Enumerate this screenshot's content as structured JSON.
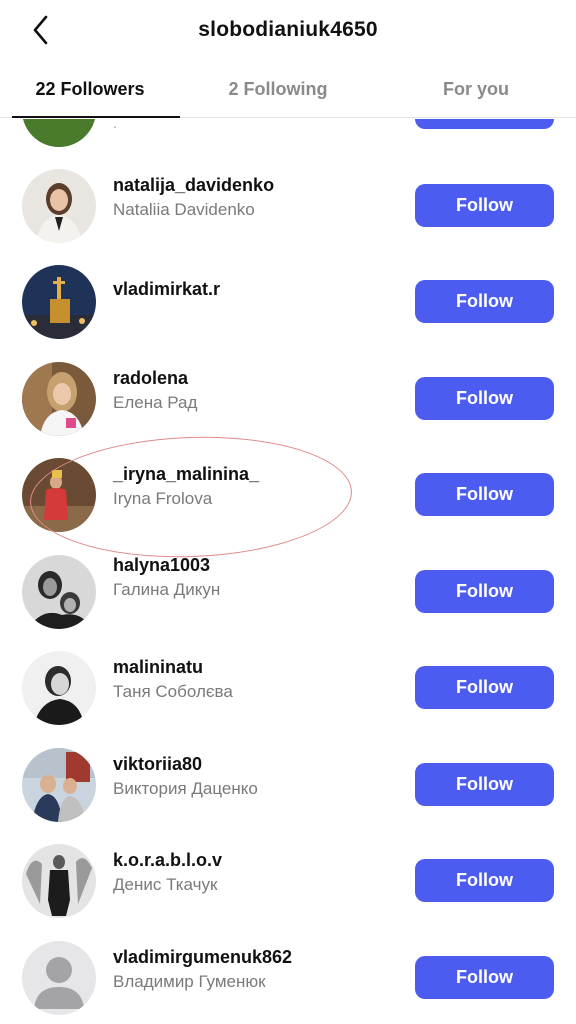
{
  "header": {
    "title": "slobodianiuk4650"
  },
  "tabs": [
    {
      "label": "22 Followers"
    },
    {
      "label": "2 Following"
    },
    {
      "label": "For you"
    }
  ],
  "partial_row": {
    "username": "."
  },
  "follow_label": "Follow",
  "followers": [
    {
      "username": "natalija_davidenko",
      "fullname": "Nataliia Davidenko"
    },
    {
      "username": "vladimirkat.r",
      "fullname": ""
    },
    {
      "username": "radolena",
      "fullname": "Елена Рад"
    },
    {
      "username": "_iryna_malinina_",
      "fullname": "Iryna Frolova"
    },
    {
      "username": "halyna1003",
      "fullname": "Галина Дикун"
    },
    {
      "username": "malininatu",
      "fullname": "Таня Соболєва"
    },
    {
      "username": "viktoriia80",
      "fullname": "Виктория Даценко"
    },
    {
      "username": "k.o.r.a.b.l.o.v",
      "fullname": "Денис Ткачук"
    },
    {
      "username": "vladimirgumenuk862",
      "fullname": "Владимир Гуменюк"
    }
  ],
  "colors": {
    "follow_button": "#4d5cf0",
    "annotation_circle": "#e08a8a"
  }
}
